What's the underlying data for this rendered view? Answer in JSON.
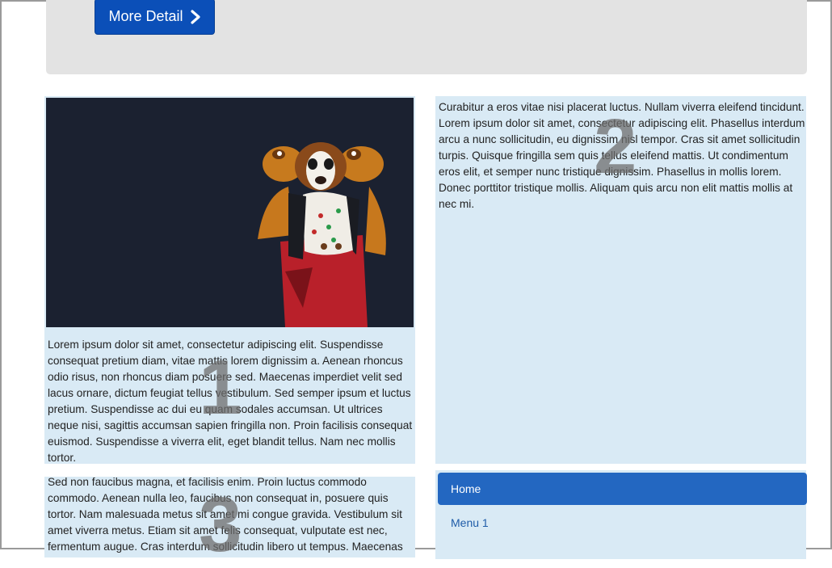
{
  "jumbotron": {
    "button_label": "More Detail",
    "button_icon": "chevron-right-icon",
    "button_color": "#0b4fb8"
  },
  "panels": [
    {
      "number": "1",
      "image": "figurine-photo",
      "text": "Lorem ipsum dolor sit amet, consectetur adipiscing elit. Suspendisse consequat pretium diam, vitae mattis lorem dignissim a. Aenean rhoncus odio risus, non rhoncus diam posuere sed. Maecenas imperdiet velit sed lacus ornare, dictum feugiat tellus vestibulum. Sed semper ipsum et luctus pretium. Suspendisse ac dui eu quam sodales accumsan. Ut ultrices neque nisi, sagittis accumsan sapien fringilla non. Proin facilisis consequat euismod. Suspendisse a viverra elit, eget blandit tellus. Nam nec mollis tortor."
    },
    {
      "number": "2",
      "text": "Curabitur a eros vitae nisi placerat luctus. Nullam viverra eleifend tincidunt. Lorem ipsum dolor sit amet, consectetur adipiscing elit. Phasellus interdum arcu a nunc sollicitudin, eu dignissim nisl tempor. Cras sit amet sollicitudin turpis. Quisque fringilla sem quis tellus eleifend mattis. Ut condimentum eros elit, et semper nunc tristique dignissim. Phasellus in mollis lorem. Donec porttitor tristique mollis. Aliquam quis arcu non elit mattis mollis at nec mi."
    },
    {
      "number": "3",
      "text": "Sed non faucibus magna, et facilisis enim. Proin luctus commodo commodo. Aenean nulla leo, faucibus non consequat in, posuere quis tortor. Nam malesuada metus sit amet mi congue gravida. Vestibulum sit amet viverra metus. Etiam sit amet felis consequat, vulputate est nec, fermentum augue. Cras interdum sollicitudin libero ut tempus. Maecenas"
    }
  ],
  "nav": {
    "items": [
      {
        "label": "Home",
        "active": true
      },
      {
        "label": "Menu 1",
        "active": false
      }
    ],
    "active_color": "#2367c1"
  },
  "colors": {
    "panel_bg": "#d9eaf5",
    "jumbotron_bg": "#e3e3e3"
  }
}
